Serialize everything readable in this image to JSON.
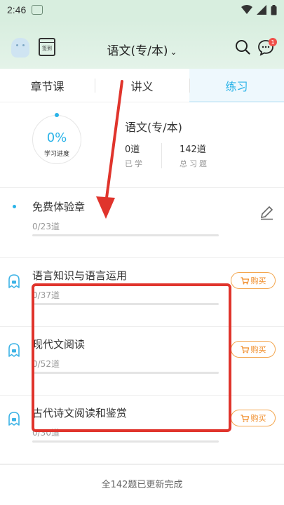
{
  "status_bar": {
    "time": "2:46"
  },
  "header": {
    "calendar_label": "签到",
    "course_title": "语文(专/本)",
    "chevron": "⌄",
    "message_badge": "1"
  },
  "tabs": [
    {
      "label": "章节课",
      "active": false
    },
    {
      "label": "讲义",
      "active": false
    },
    {
      "label": "练习",
      "active": true
    }
  ],
  "summary": {
    "progress_percent": "0%",
    "progress_label": "学习进度",
    "title": "语文(专/本)",
    "learned_count": "0道",
    "learned_label": "已学",
    "total_count": "142道",
    "total_label": "总习题"
  },
  "chapters": [
    {
      "name": "免费体验章",
      "count": "0/23道",
      "locked": false,
      "progress": 0
    },
    {
      "name": "语言知识与语言运用",
      "count": "0/37道",
      "locked": true,
      "progress": 0,
      "buy_label": "购买"
    },
    {
      "name": "现代文阅读",
      "count": "0/52道",
      "locked": true,
      "progress": 0,
      "buy_label": "购买"
    },
    {
      "name": "古代诗文阅读和鉴赏",
      "count": "0/30道",
      "locked": true,
      "progress": 0,
      "buy_label": "购买"
    }
  ],
  "footer": {
    "note": "全142题已更新完成"
  },
  "colors": {
    "accent": "#2ab3e8",
    "buy": "#f08a24",
    "annotation": "#e0342c",
    "header_bg": "#d8eedf"
  },
  "icons": [
    "avatar-icon",
    "calendar-icon",
    "search-icon",
    "message-icon",
    "edit-icon",
    "lock-icon",
    "cart-icon"
  ]
}
